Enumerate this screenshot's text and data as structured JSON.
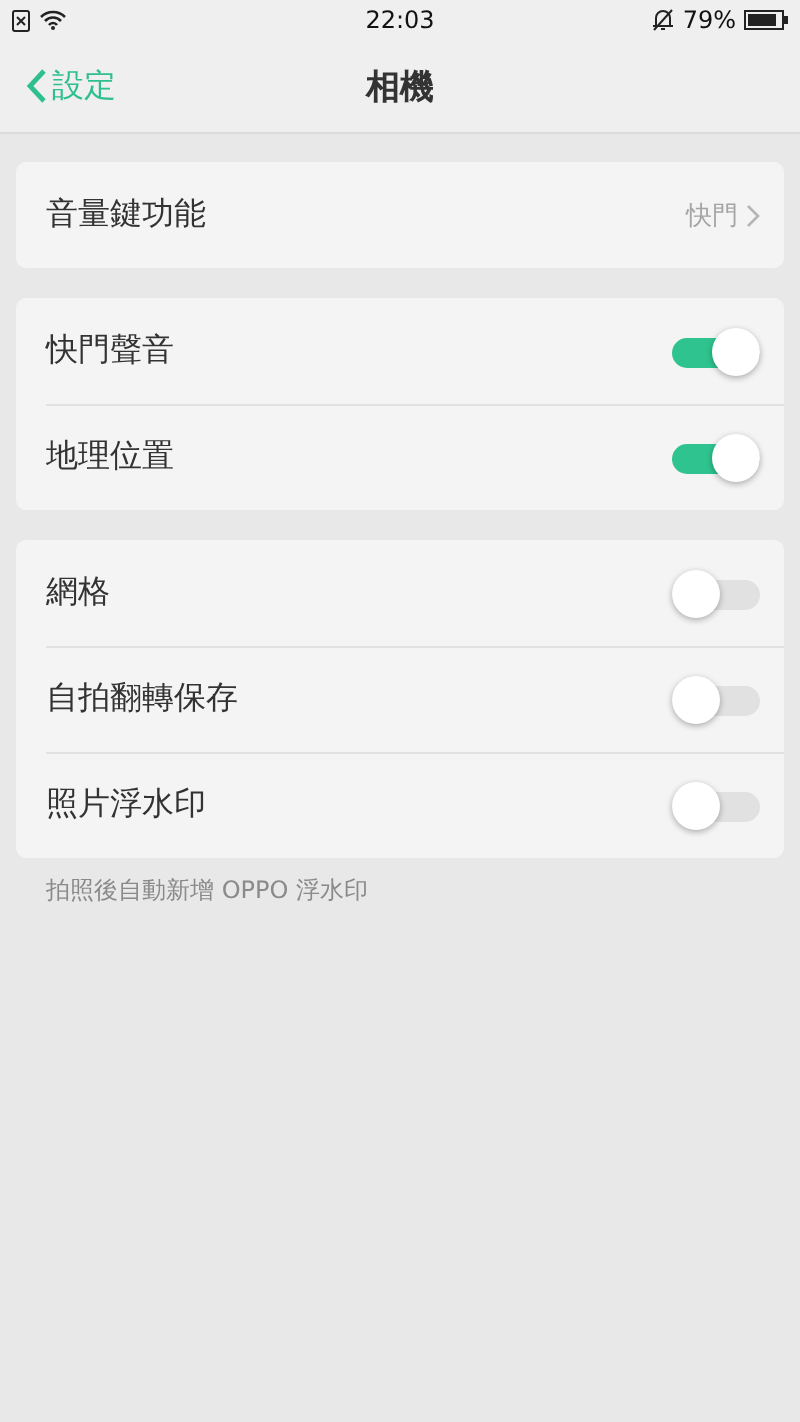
{
  "status_bar": {
    "time": "22:03",
    "battery": "79%"
  },
  "nav": {
    "back_label": "設定",
    "title": "相機"
  },
  "groups": [
    {
      "items": [
        {
          "kind": "link",
          "label": "音量鍵功能",
          "value": "快門"
        }
      ]
    },
    {
      "items": [
        {
          "kind": "toggle",
          "label": "快門聲音",
          "on": true
        },
        {
          "kind": "toggle",
          "label": "地理位置",
          "on": true
        }
      ]
    },
    {
      "items": [
        {
          "kind": "toggle",
          "label": "網格",
          "on": false
        },
        {
          "kind": "toggle",
          "label": "自拍翻轉保存",
          "on": false
        },
        {
          "kind": "toggle",
          "label": "照片浮水印",
          "on": false
        }
      ],
      "footnote": "拍照後自動新增 OPPO 浮水印"
    }
  ]
}
